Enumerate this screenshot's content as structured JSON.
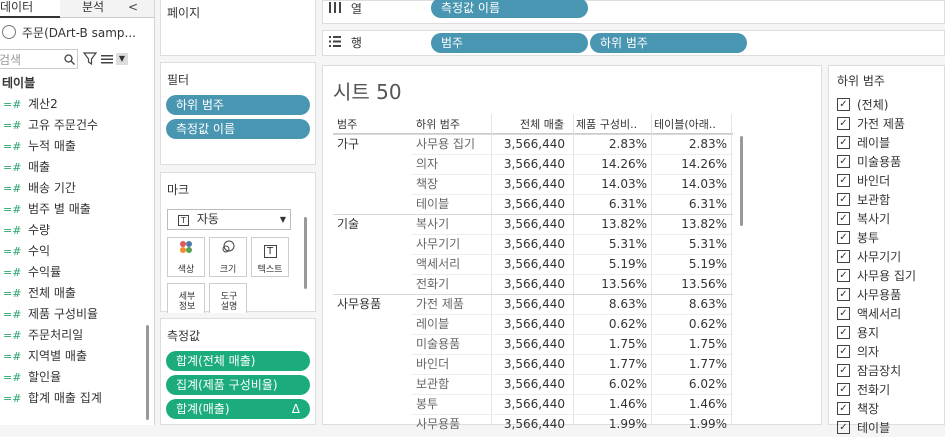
{
  "left": {
    "tabs": [
      "데이터",
      "분석"
    ],
    "tab_arrow": "<",
    "datasource": "주문(DArt-B samp...",
    "search_placeholder": "검색",
    "table_header": "테이블",
    "fields": [
      "계산2",
      "고유 주문건수",
      "누적 매출",
      "매출",
      "배송 기간",
      "범주 별 매출",
      "수량",
      "수익",
      "수익률",
      "전체 매출",
      "제품 구성비율",
      "주문처리일",
      "지역별 매출",
      "할인율",
      "합계 매출 집계"
    ]
  },
  "shelves": {
    "pages_title": "페이지",
    "filters_title": "필터",
    "filters": [
      "하위 범주",
      "측정값 이름"
    ],
    "marks_title": "마크",
    "marks_type": "자동",
    "mark_buttons": [
      "색상",
      "크기",
      "텍스트",
      "세부 정보",
      "도구 설명"
    ],
    "measures_title": "측정값",
    "measures": [
      "합계(전체 매출)",
      "집계(제품 구성비율)",
      "합계(매출)"
    ],
    "delta": "Δ"
  },
  "top": {
    "columns_label": "열",
    "columns_pill": "측정값 이름",
    "rows_label": "행",
    "rows_pills": [
      "범주",
      "하위 범주"
    ]
  },
  "sheet": {
    "title": "시트 50",
    "headers": [
      "범주",
      "하위 범주",
      "전체 매출",
      "제품 구성비..",
      "테이블(아래.."
    ],
    "rows": [
      {
        "cat": "가구",
        "sub": "사무용 집기",
        "total": "3,566,440",
        "p1": "2.83%",
        "p2": "2.83%"
      },
      {
        "cat": "",
        "sub": "의자",
        "total": "3,566,440",
        "p1": "14.26%",
        "p2": "14.26%"
      },
      {
        "cat": "",
        "sub": "책장",
        "total": "3,566,440",
        "p1": "14.03%",
        "p2": "14.03%"
      },
      {
        "cat": "",
        "sub": "테이블",
        "total": "3,566,440",
        "p1": "6.31%",
        "p2": "6.31%"
      },
      {
        "cat": "기술",
        "sub": "복사기",
        "total": "3,566,440",
        "p1": "13.82%",
        "p2": "13.82%"
      },
      {
        "cat": "",
        "sub": "사무기기",
        "total": "3,566,440",
        "p1": "5.31%",
        "p2": "5.31%"
      },
      {
        "cat": "",
        "sub": "액세서리",
        "total": "3,566,440",
        "p1": "5.19%",
        "p2": "5.19%"
      },
      {
        "cat": "",
        "sub": "전화기",
        "total": "3,566,440",
        "p1": "13.56%",
        "p2": "13.56%"
      },
      {
        "cat": "사무용품",
        "sub": "가전 제품",
        "total": "3,566,440",
        "p1": "8.63%",
        "p2": "8.63%"
      },
      {
        "cat": "",
        "sub": "레이블",
        "total": "3,566,440",
        "p1": "0.62%",
        "p2": "0.62%"
      },
      {
        "cat": "",
        "sub": "미술용품",
        "total": "3,566,440",
        "p1": "1.75%",
        "p2": "1.75%"
      },
      {
        "cat": "",
        "sub": "바인더",
        "total": "3,566,440",
        "p1": "1.77%",
        "p2": "1.77%"
      },
      {
        "cat": "",
        "sub": "보관함",
        "total": "3,566,440",
        "p1": "6.02%",
        "p2": "6.02%"
      },
      {
        "cat": "",
        "sub": "봉투",
        "total": "3,566,440",
        "p1": "1.46%",
        "p2": "1.46%"
      },
      {
        "cat": "",
        "sub": "사무용품",
        "total": "3,566,440",
        "p1": "1.99%",
        "p2": "1.99%"
      }
    ]
  },
  "legend": {
    "title": "하위 범주",
    "items": [
      "(전체)",
      "가전 제품",
      "레이블",
      "미술용품",
      "바인더",
      "보관함",
      "복사기",
      "봉투",
      "사무기기",
      "사무용 집기",
      "사무용품",
      "액세서리",
      "용지",
      "의자",
      "잠금장치",
      "전화기",
      "책장",
      "테이블"
    ],
    "check": "✓"
  },
  "colors": {
    "blue_pill": "#4996b2",
    "green_pill": "#1bab7c"
  }
}
